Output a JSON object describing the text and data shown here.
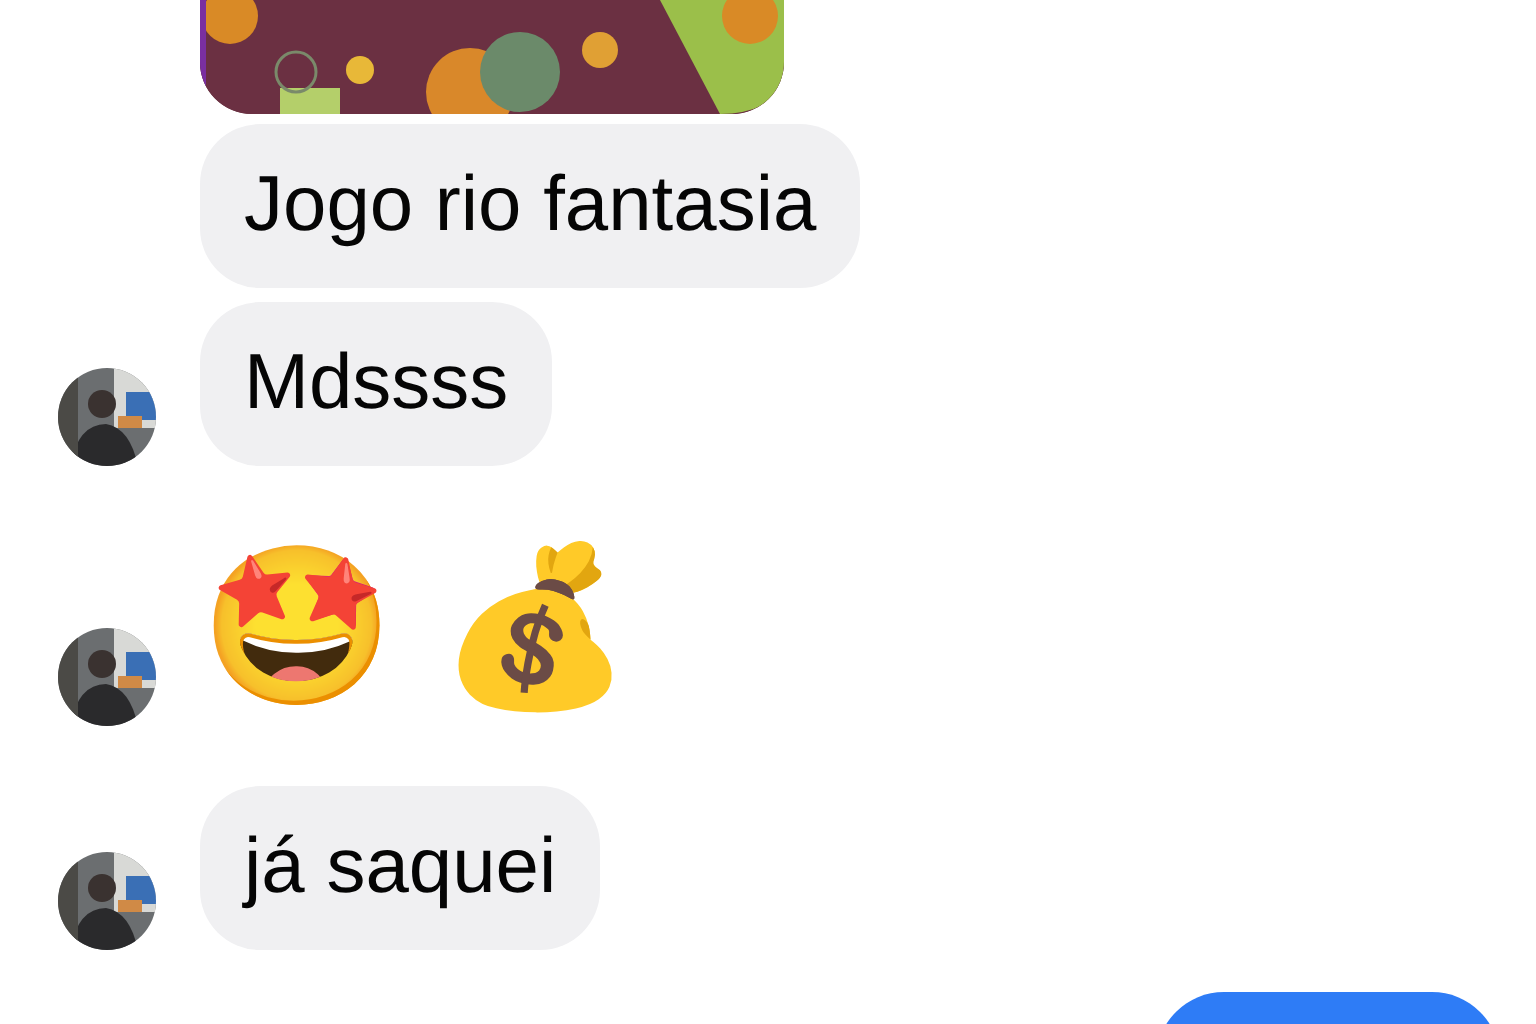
{
  "messages": [
    {
      "kind": "picture",
      "avatar": false
    },
    {
      "kind": "text",
      "text": "Jogo rio fantasia",
      "avatar": false
    },
    {
      "kind": "text",
      "text": "Mdssss",
      "avatar": true
    },
    {
      "kind": "emoji",
      "emojis": [
        "🤩",
        "💰"
      ],
      "avatar": true
    },
    {
      "kind": "text",
      "text": "já saquei",
      "avatar": true
    },
    {
      "kind": "outgoing",
      "avatar": false
    }
  ]
}
